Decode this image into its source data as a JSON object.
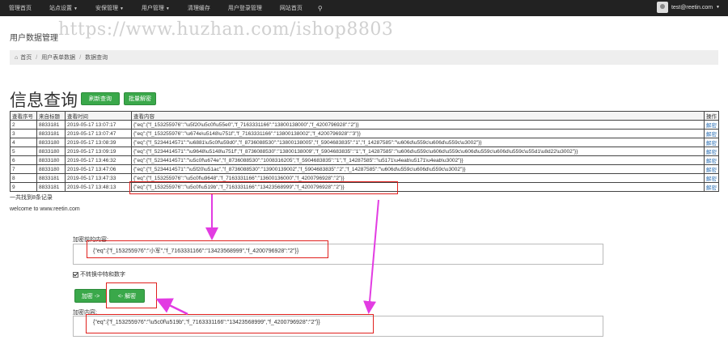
{
  "nav": {
    "items": [
      {
        "label": "管理首页",
        "caret": false
      },
      {
        "label": "站点设置",
        "caret": true
      },
      {
        "label": "安保管理",
        "caret": true
      },
      {
        "label": "用户管理",
        "caret": true
      },
      {
        "label": "清理缓存",
        "caret": false
      },
      {
        "label": "用户登录管理",
        "caret": false
      },
      {
        "label": "网站首页",
        "caret": false
      }
    ],
    "search_icon": "search-icon",
    "user_email": "test@reetin.com",
    "avatar_icon": "user-avatar-icon"
  },
  "subtitle": "用户数据管理",
  "watermark": "https://www.huzhan.com/ishop8803",
  "breadcrumb": {
    "home_icon": "home-icon",
    "items": [
      "首页",
      "用户表单数据",
      "数据查询"
    ]
  },
  "page_title": "信息查询",
  "buttons": {
    "refresh": "刷新查询",
    "batch_decrypt": "批量解密",
    "encrypt": "加密 ->",
    "decrypt": "<- 解密"
  },
  "table": {
    "headers": [
      "查看序号",
      "来自标题",
      "查看时间",
      "查看内容",
      "操作"
    ],
    "rows": [
      {
        "id": "2",
        "source": "8833181",
        "time": "2019-05-17 13:07:17",
        "content": "{\"eq\":{\"f_153255976\":\"\\u5f20\\u5c0f\\u55e0\",\"f_7163331166\":\"13800138000\",\"f_4200796928\":\"2\"}}",
        "action": "解密"
      },
      {
        "id": "3",
        "source": "8833181",
        "time": "2019-05-17 13:07:47",
        "content": "{\"eq\":{\"f_153255976\":\"\\u674e\\u5148\\u751f\",\"f_7163331166\":\"13800138002\",\"f_4200796928\":\"3\"}}",
        "action": "解密"
      },
      {
        "id": "4",
        "source": "8833180",
        "time": "2019-05-17 13:08:39",
        "content": "{\"eq\":{\"f_5234414571\":\"\\u6881\\u5c0f\\u59d0\",\"f_8736088530\":\"13800138005\",\"f_5904683835\":\"1\",\"f_14287585\":\"\\u606d\\u559c\\u606d\\u559c\\u3002\"}}",
        "action": "解密"
      },
      {
        "id": "5",
        "source": "8833180",
        "time": "2019-05-17 13:09:19",
        "content": "{\"eq\":{\"f_5234414571\":\"\\u9648\\u5148\\u751f\",\"f_8736088530\":\"13800138009\",\"f_5904683835\":\"1\",\"f_14287585\":\"\\u606d\\u559c\\u606d\\u559c\\u606d\\u559c\\u606d\\u559c\\u55d1\\u8d22\\u3002\"}}",
        "action": "解密"
      },
      {
        "id": "6",
        "source": "8833180",
        "time": "2019-05-17 13:46:32",
        "content": "{\"eq\":{\"f_5234414571\":\"\\u5c0f\\u674e\",\"f_8736088530\":\"1008316205\",\"f_5904683835\":\"1\",\"f_14287585\":\"\\u5171\\u4eab\\u5171\\u4eab\\u3002\"}}",
        "action": "解密"
      },
      {
        "id": "7",
        "source": "8833180",
        "time": "2019-05-17 13:47:06",
        "content": "{\"eq\":{\"f_5234414571\":\"\\u5f20\\u51ac\",\"f_8736088530\":\"13900139002\",\"f_5904683835\":\"2\",\"f_14287585\":\"\\u606d\\u559c\\u606d\\u559c\\u3002\"}}",
        "action": "解密"
      },
      {
        "id": "8",
        "source": "8833181",
        "time": "2019-05-17 13:47:33",
        "content": "{\"eq\":{\"f_153255976\":\"\\u5c0f\\u9648\",\"f_7163331166\":\"13600136000\",\"f_4200796928\":\"2\"}}",
        "action": "解密"
      },
      {
        "id": "9",
        "source": "8833181",
        "time": "2019-05-17 13:48:13",
        "content": "{\"eq\":{\"f_153255976\":\"\\u5c0f\\u519b\",\"f_7163331166\":\"13423568999\",\"f_4200796928\":\"2\"}}",
        "action": "解密"
      }
    ]
  },
  "count_text": "一共找到8条记录",
  "welcome": "welcome to www.reetin.com",
  "encrypt_label": "加密前的内容:",
  "plain_text": "{\"eq\":{\"f_153255976\":\"小军\",\"f_7163331166\":\"13423568999\",\"f_4200796928\":\"2\"}}",
  "checkbox_label": "不转换中特和数字",
  "cipher_label": "加密内容:",
  "cipher_text": "{\"eq\":{\"f_153255976\":\"\\u5c0f\\u519b\",\"f_7163331166\":\"13423568999\",\"f_4200796928\":\"2\"}}",
  "colors": {
    "nav_bg": "#222222",
    "button_green": "#3aa84a",
    "highlight_red": "#e0201d",
    "arrow_magenta": "#e23ce2"
  }
}
